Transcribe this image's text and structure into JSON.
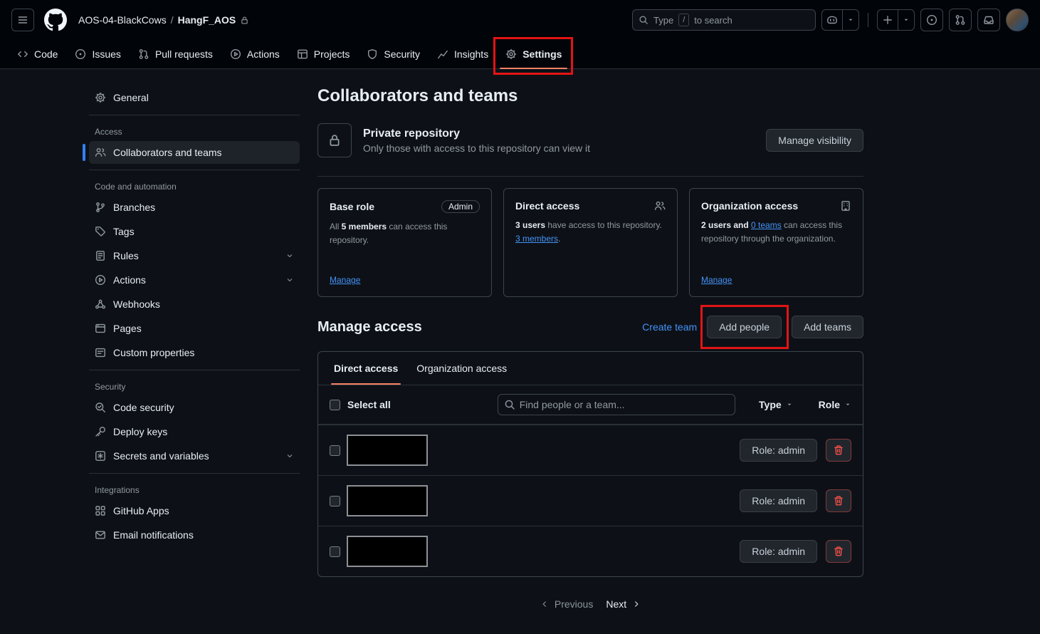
{
  "colors": {
    "accent_blue": "#4493f8",
    "tab_active_underline": "#f78166",
    "danger_red": "#f85149",
    "annotation_red": "#e31414",
    "page_background": "#0d1117",
    "header_background": "#010409"
  },
  "icons": [
    "menu-icon",
    "github-logo",
    "lock-icon",
    "search-icon",
    "copilot-icon",
    "caret-down-icon",
    "plus-icon",
    "issue-opened-icon",
    "git-pull-request-icon",
    "inbox-icon",
    "code-icon",
    "play-icon",
    "table-icon",
    "shield-icon",
    "graph-icon",
    "gear-icon",
    "people-icon",
    "git-branch-icon",
    "tag-icon",
    "rules-icon",
    "webhook-icon",
    "browser-icon",
    "note-icon",
    "codescan-icon",
    "key-icon",
    "asterisk-icon",
    "apps-icon",
    "mail-icon",
    "organization-icon",
    "chevron-down-icon",
    "chevron-left-icon",
    "chevron-right-icon",
    "trash-icon"
  ],
  "header": {
    "org": "AOS-04-BlackCows",
    "separator": "/",
    "repo": "HangF_AOS",
    "search": {
      "prefix": "Type",
      "key_hint": "/",
      "suffix": "to search"
    }
  },
  "repo_nav": {
    "tabs": [
      {
        "label": "Code"
      },
      {
        "label": "Issues"
      },
      {
        "label": "Pull requests"
      },
      {
        "label": "Actions"
      },
      {
        "label": "Projects"
      },
      {
        "label": "Security"
      },
      {
        "label": "Insights"
      },
      {
        "label": "Settings"
      }
    ]
  },
  "sidebar": {
    "general_label": "General",
    "access_title": "Access",
    "collaborators_label": "Collaborators and teams",
    "code_automation_title": "Code and automation",
    "items": {
      "branches": "Branches",
      "tags": "Tags",
      "rules": "Rules",
      "actions": "Actions",
      "webhooks": "Webhooks",
      "pages": "Pages",
      "custom_properties": "Custom properties"
    },
    "security_title": "Security",
    "security_items": {
      "code_security": "Code security",
      "deploy_keys": "Deploy keys",
      "secrets": "Secrets and variables"
    },
    "integrations_title": "Integrations",
    "integrations_items": {
      "github_apps": "GitHub Apps",
      "email_notifications": "Email notifications"
    }
  },
  "main": {
    "page_title": "Collaborators and teams",
    "visibility": {
      "title": "Private repository",
      "description": "Only those with access to this repository can view it",
      "button": "Manage visibility"
    },
    "base_role_card": {
      "title": "Base role",
      "badge": "Admin",
      "text_prefix": "All ",
      "text_bold": "5 members",
      "text_suffix": " can access this repository.",
      "link": "Manage"
    },
    "direct_access_card": {
      "title": "Direct access",
      "text_bold": "3 users",
      "text_mid": " have access to this repository. ",
      "link": "3 members",
      "text_period": "."
    },
    "org_access_card": {
      "title": "Organization access",
      "text_bold": "2 users and ",
      "link_inline": "0 teams",
      "text_suffix": " can access this repository through the organization.",
      "link": "Manage"
    },
    "manage_access": {
      "title": "Manage access",
      "create_team": "Create team",
      "add_people": "Add people",
      "add_teams": "Add teams"
    },
    "access_table": {
      "tab_direct": "Direct access",
      "tab_org": "Organization access",
      "select_all": "Select all",
      "search_placeholder": "Find people or a team...",
      "type_label": "Type",
      "role_label": "Role",
      "rows": [
        {
          "role_button": "Role: admin"
        },
        {
          "role_button": "Role: admin"
        },
        {
          "role_button": "Role: admin"
        }
      ]
    },
    "pagination": {
      "previous": "Previous",
      "next": "Next"
    }
  }
}
